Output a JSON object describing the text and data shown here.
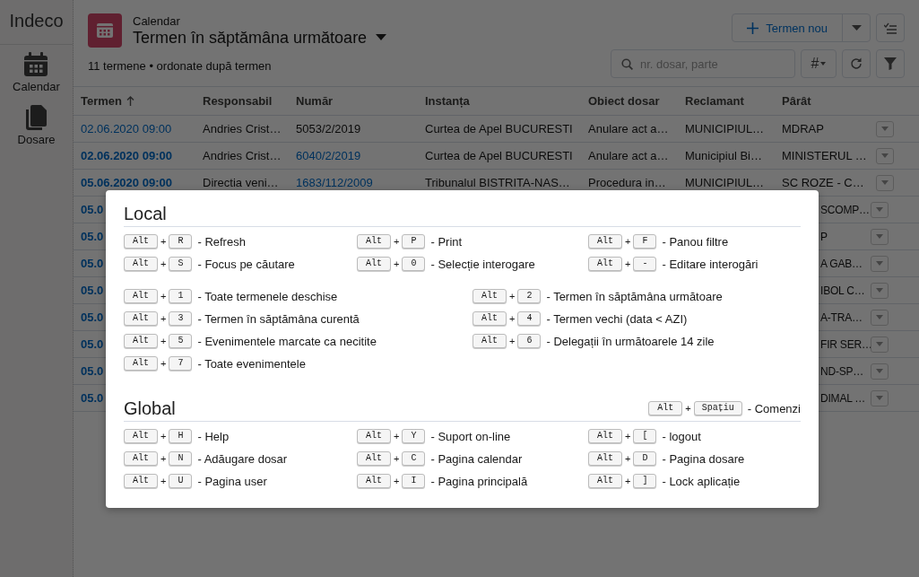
{
  "app": {
    "logo": "Indeco"
  },
  "sidebar": {
    "items": [
      {
        "label": "Calendar"
      },
      {
        "label": "Dosare"
      }
    ]
  },
  "header": {
    "section": "Calendar",
    "title": "Termen în săptămâna următoare",
    "summary": "11 termene • ordonate după termen",
    "new_button": "Termen nou",
    "search": {
      "placeholder": "nr. dosar, parte"
    },
    "display_button": "#"
  },
  "table": {
    "columns": [
      {
        "label": "Termen",
        "sorted": true
      },
      {
        "label": "Responsabil",
        "sorted": false
      },
      {
        "label": "Număr",
        "sorted": false
      },
      {
        "label": "Instanța",
        "sorted": false
      },
      {
        "label": "Obiect dosar",
        "sorted": false
      },
      {
        "label": "Reclamant",
        "sorted": false
      },
      {
        "label": "Pârât",
        "sorted": false
      }
    ],
    "rows": [
      {
        "unread": false,
        "termen": "02.06.2020 09:00",
        "responsabil": "Andries Crist…",
        "numar": "5053/2/2019",
        "numar_link": false,
        "instanta": "Curtea de Apel BUCURESTI",
        "obiect": "Anulare act a…",
        "reclamant": "MUNICIPIUL…",
        "parat": "MDRAP"
      },
      {
        "unread": true,
        "termen": "02.06.2020 09:00",
        "responsabil": "Andries Crist…",
        "numar": "6040/2/2019",
        "numar_link": true,
        "instanta": "Curtea de Apel BUCURESTI",
        "obiect": "Anulare act a…",
        "reclamant": "Municipiul Bi…",
        "parat": "MINISTERUL …"
      },
      {
        "unread": true,
        "termen": "05.06.2020 09:00",
        "responsabil": "Directia veni…",
        "numar": "1683/112/2009",
        "numar_link": true,
        "instanta": "Tribunalul BISTRITA-NAS…",
        "obiect": "Procedura in…",
        "reclamant": "MUNICIPIUL…",
        "parat": "SC ROZE - C…"
      },
      {
        "unread": true,
        "termen": "05.0",
        "parat": "SCOMP…"
      },
      {
        "unread": true,
        "termen": "05.0",
        "parat": "P"
      },
      {
        "unread": true,
        "termen": "05.0",
        "parat": "A GAB…"
      },
      {
        "unread": true,
        "termen": "05.0",
        "parat": "IBOL C…"
      },
      {
        "unread": true,
        "termen": "05.0",
        "parat": "A-TRA…"
      },
      {
        "unread": true,
        "termen": "05.0",
        "parat": "FIR SER…"
      },
      {
        "unread": true,
        "termen": "05.0",
        "parat": "ND-SP…"
      },
      {
        "unread": true,
        "termen": "05.0",
        "parat": "DIMAL …"
      }
    ]
  },
  "shortcuts_dialog": {
    "groups": [
      {
        "title": "Local",
        "blocks": [
          {
            "kind": "three-column",
            "items": [
              {
                "modifier": "Alt",
                "plus": "+",
                "key": "R",
                "label": "- Refresh"
              },
              {
                "modifier": "Alt",
                "plus": "+",
                "key": "P",
                "label": "- Print"
              },
              {
                "modifier": "Alt",
                "plus": "+",
                "key": "F",
                "label": "- Panou filtre"
              },
              {
                "modifier": "Alt",
                "plus": "+",
                "key": "S",
                "label": "- Focus pe căutare"
              },
              {
                "modifier": "Alt",
                "plus": "+",
                "key": "0",
                "label": "- Selecție interogare"
              },
              {
                "modifier": "Alt",
                "plus": "+",
                "key": "-",
                "label": "- Editare interogări"
              }
            ]
          },
          {
            "kind": "two-column",
            "items": [
              {
                "modifier": "Alt",
                "plus": "+",
                "key": "1",
                "label": "- Toate termenele deschise"
              },
              {
                "modifier": "Alt",
                "plus": "+",
                "key": "2",
                "label": "- Termen în săptămâna următoare"
              },
              {
                "modifier": "Alt",
                "plus": "+",
                "key": "3",
                "label": "- Termen în săptămâna curentă"
              },
              {
                "modifier": "Alt",
                "plus": "+",
                "key": "4",
                "label": "- Termen vechi (data < AZI)"
              },
              {
                "modifier": "Alt",
                "plus": "+",
                "key": "5",
                "label": "- Evenimentele marcate ca necitite"
              },
              {
                "modifier": "Alt",
                "plus": "+",
                "key": "6",
                "label": "- Delegații în următoarele 14 zile"
              },
              {
                "modifier": "Alt",
                "plus": "+",
                "key": "7",
                "label": "- Toate evenimentele"
              }
            ]
          }
        ]
      },
      {
        "title": "Global",
        "extra": {
          "modifier": "Alt",
          "plus": "+",
          "key": "Spațiu",
          "label": "- Comenzi"
        },
        "blocks": [
          {
            "kind": "three-column",
            "items": [
              {
                "modifier": "Alt",
                "plus": "+",
                "key": "H",
                "label": "- Help"
              },
              {
                "modifier": "Alt",
                "plus": "+",
                "key": "Y",
                "label": "- Suport on-line"
              },
              {
                "modifier": "Alt",
                "plus": "+",
                "key": "[",
                "label": "- logout"
              },
              {
                "modifier": "Alt",
                "plus": "+",
                "key": "N",
                "label": "- Adăugare dosar"
              },
              {
                "modifier": "Alt",
                "plus": "+",
                "key": "C",
                "label": "- Pagina calendar"
              },
              {
                "modifier": "Alt",
                "plus": "+",
                "key": "D",
                "label": "- Pagina dosare"
              },
              {
                "modifier": "Alt",
                "plus": "+",
                "key": "U",
                "label": "- Pagina user"
              },
              {
                "modifier": "Alt",
                "plus": "+",
                "key": "I",
                "label": "- Pagina principală"
              },
              {
                "modifier": "Alt",
                "plus": "+",
                "key": "]",
                "label": "- Lock aplicație"
              }
            ]
          }
        ]
      }
    ]
  }
}
